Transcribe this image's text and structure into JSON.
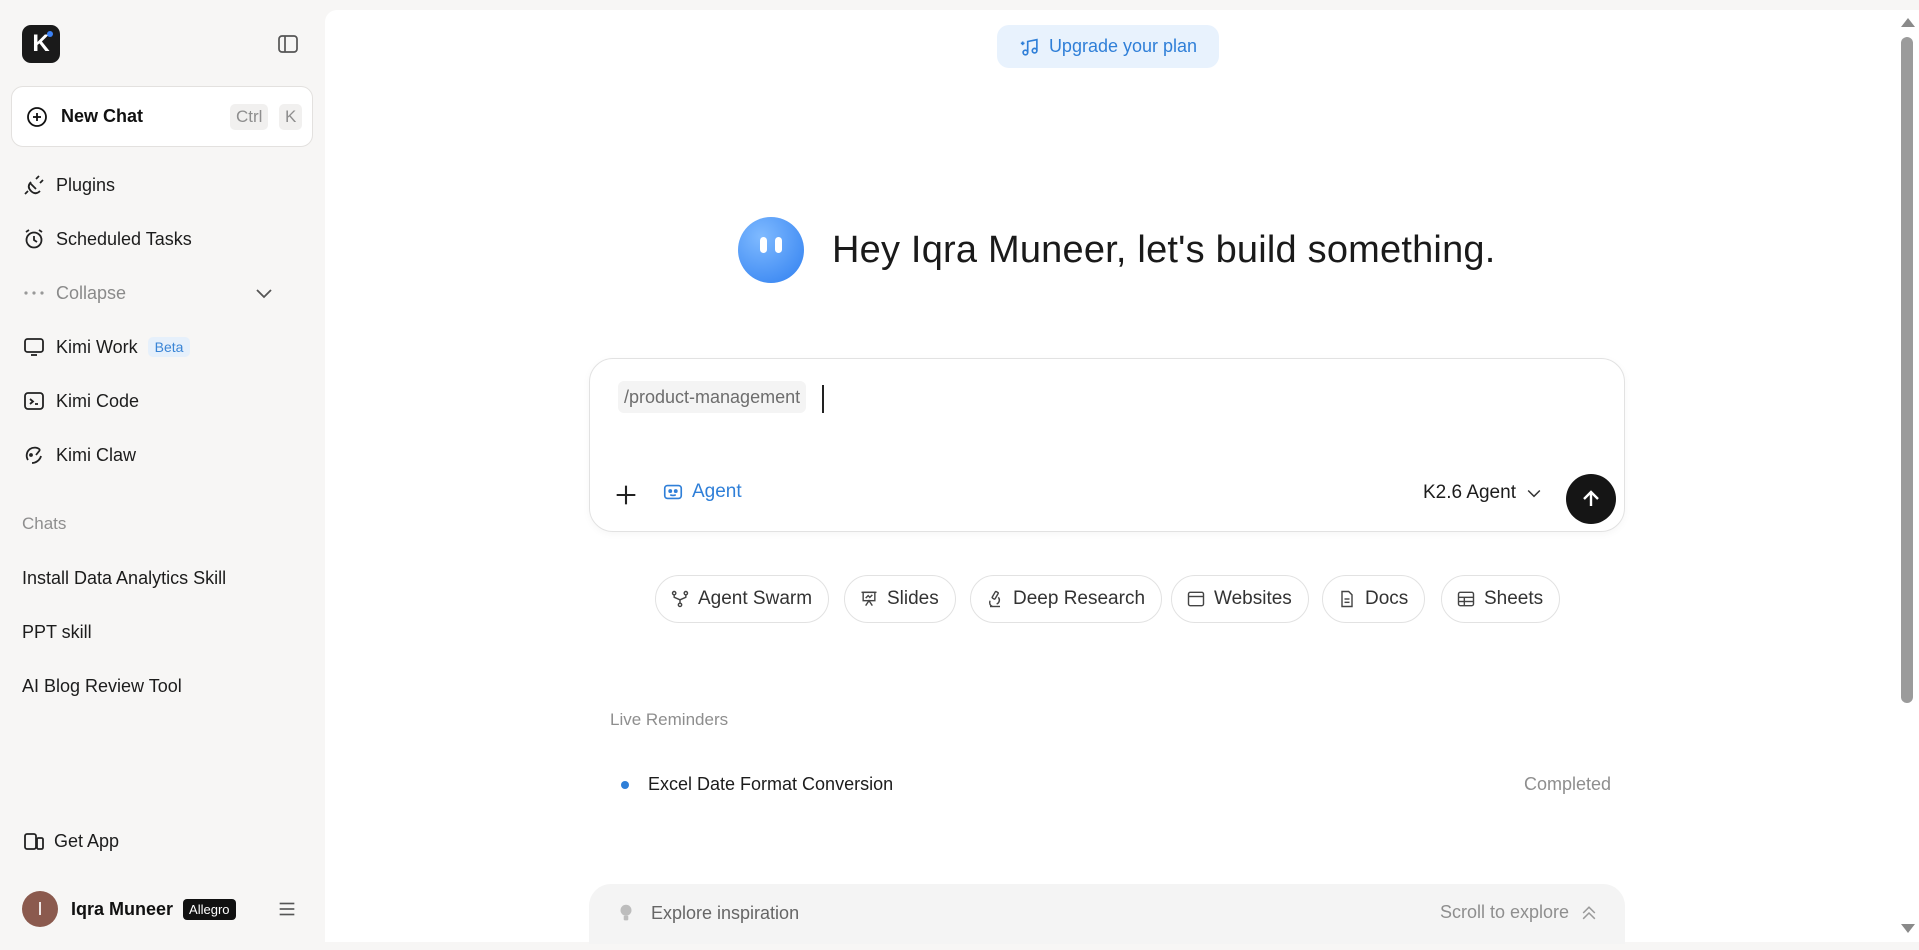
{
  "sidebar": {
    "logo_text": "K",
    "new_chat": {
      "label": "New Chat",
      "shortcut_ctrl": "Ctrl",
      "shortcut_key": "K"
    },
    "nav": [
      {
        "label": "Plugins",
        "icon": "plug-icon"
      },
      {
        "label": "Scheduled Tasks",
        "icon": "alarm-clock-icon"
      },
      {
        "label": "Collapse",
        "icon": "more-dots-icon"
      },
      {
        "label": "Kimi Work",
        "icon": "monitor-icon",
        "badge": "Beta"
      },
      {
        "label": "Kimi Code",
        "icon": "terminal-icon"
      },
      {
        "label": "Kimi Claw",
        "icon": "claw-icon"
      }
    ],
    "chats_label": "Chats",
    "chats": [
      "Install Data Analytics Skill",
      "PPT skill",
      "AI Blog Review Tool"
    ],
    "get_app": "Get App",
    "user": {
      "avatar_initial": "I",
      "name": "Iqra Muneer",
      "plan": "Allegro"
    }
  },
  "main": {
    "upgrade_label": "Upgrade your plan",
    "greeting": "Hey Iqra Muneer, let's build something.",
    "composer": {
      "slash_command": "/product-management",
      "agent_label": "Agent",
      "model_label": "K2.6 Agent"
    },
    "chips": [
      {
        "label": "Agent Swarm",
        "icon": "swarm-icon"
      },
      {
        "label": "Slides",
        "icon": "presentation-icon"
      },
      {
        "label": "Deep Research",
        "icon": "microscope-icon"
      },
      {
        "label": "Websites",
        "icon": "browser-icon"
      },
      {
        "label": "Docs",
        "icon": "document-icon"
      },
      {
        "label": "Sheets",
        "icon": "table-icon"
      }
    ],
    "reminders": {
      "title": "Live Reminders",
      "items": [
        {
          "title": "Excel Date Format Conversion",
          "status": "Completed"
        }
      ]
    },
    "explore": {
      "label": "Explore inspiration",
      "hint": "Scroll to explore"
    }
  },
  "colors": {
    "accent": "#2f7fd8",
    "send_button": "#151515",
    "sidebar_bg": "#f7f6f5"
  }
}
